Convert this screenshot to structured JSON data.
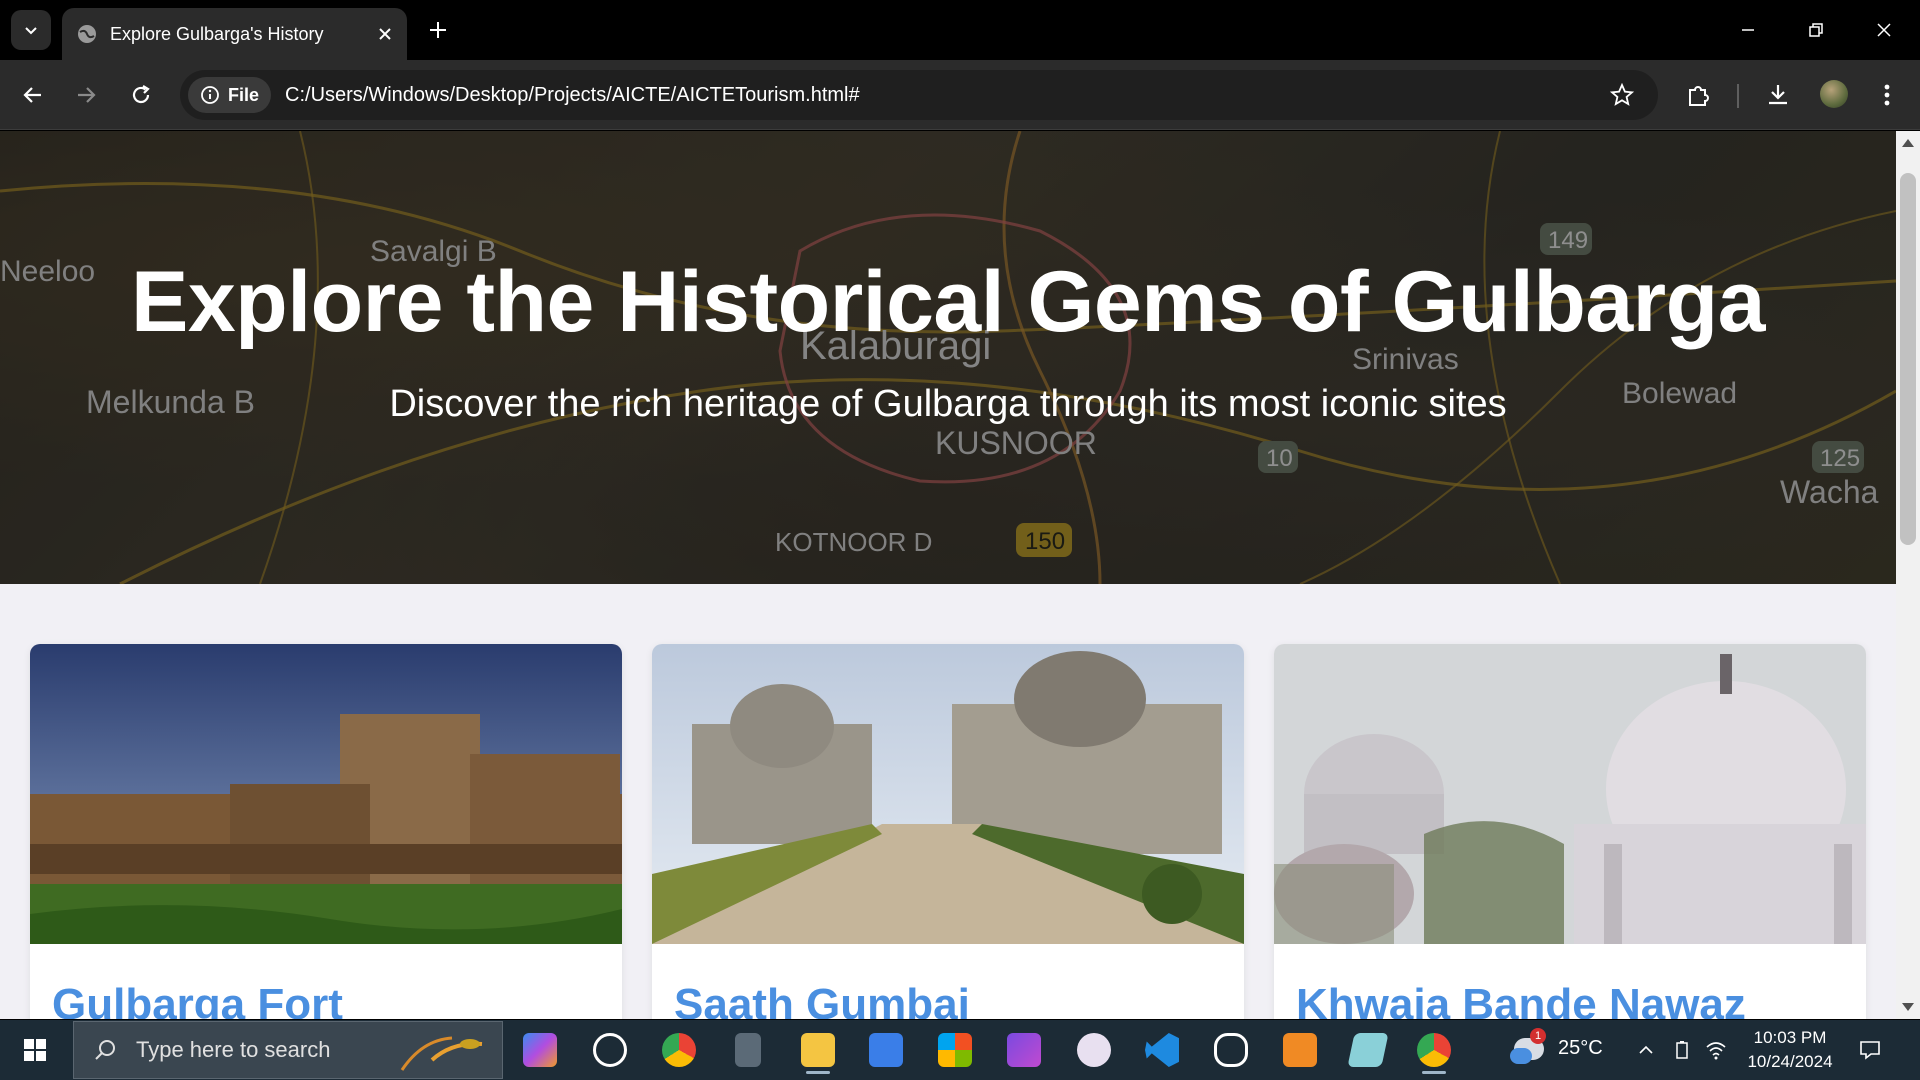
{
  "browser": {
    "tab_title": "Explore Gulbarga's History",
    "url_chip": "File",
    "url": "C:/Users/Windows/Desktop/Projects/AICTE/AICTETourism.html#"
  },
  "hero": {
    "title": "Explore the Historical Gems of Gulbarga",
    "subtitle": "Discover the rich heritage of Gulbarga through its most iconic sites",
    "map_labels": [
      {
        "text": "Savalgi B"
      },
      {
        "text": "Neeloo"
      },
      {
        "text": "Kalaburagi"
      },
      {
        "text": "Srinivas"
      },
      {
        "text": "Bolewad"
      },
      {
        "text": "Melkunda B"
      },
      {
        "text": "KUSNOOR"
      },
      {
        "text": "KOTNOOR D"
      },
      {
        "text": "Wacha"
      },
      {
        "text": "149"
      },
      {
        "text": "10"
      },
      {
        "text": "150"
      },
      {
        "text": "125"
      }
    ]
  },
  "cards": [
    {
      "title": "Gulbarga Fort"
    },
    {
      "title": "Saath Gumbaj"
    },
    {
      "title": "Khwaja Bande Nawaz"
    }
  ],
  "taskbar": {
    "search_placeholder": "Type here to search",
    "temperature": "25°C",
    "weather_badge": "1",
    "time": "10:03 PM",
    "date": "10/24/2024"
  }
}
